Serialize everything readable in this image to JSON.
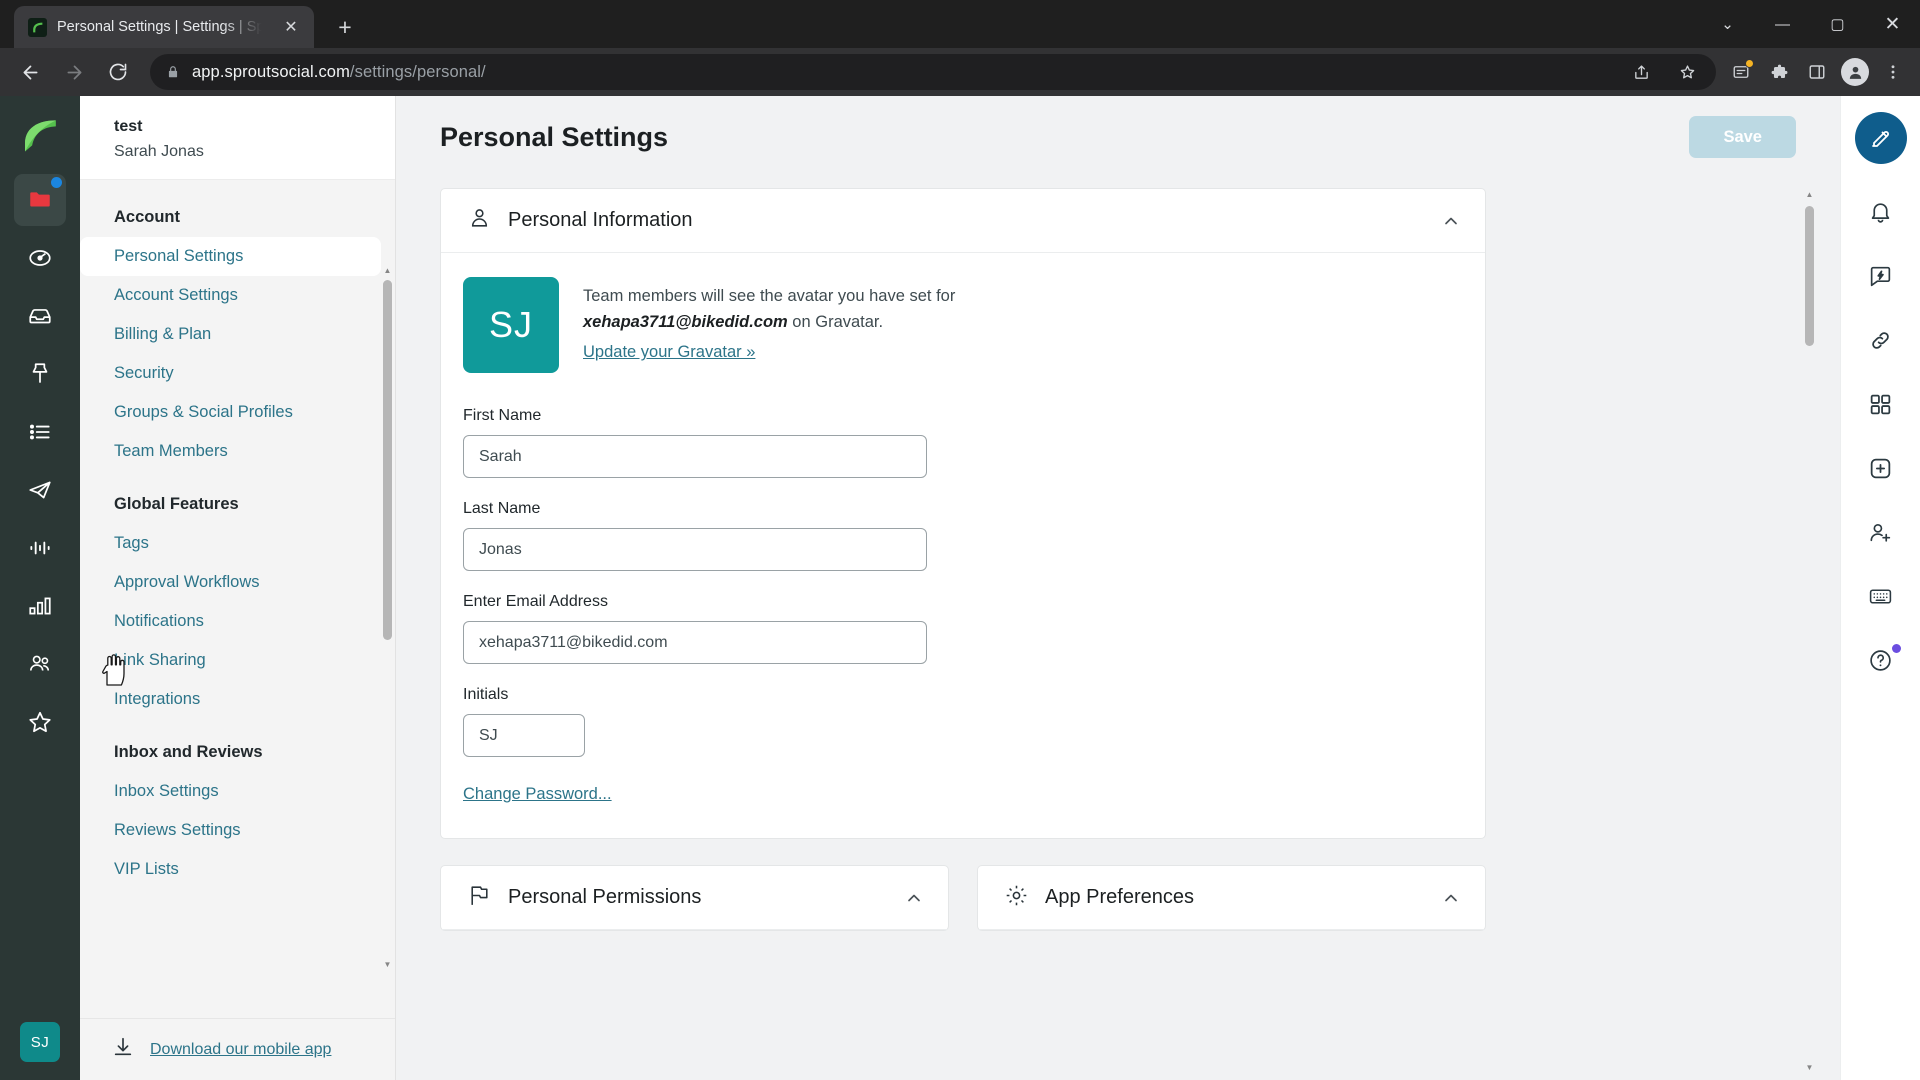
{
  "browser": {
    "tab": {
      "title": "Personal Settings | Settings | Spr",
      "favicon_name": "sprout-leaf-favicon",
      "close_label": "✕"
    },
    "new_tab_label": "+",
    "window_controls": {
      "minimize": "⌄",
      "restore": "—",
      "maximize": "▢",
      "close": "✕"
    },
    "url": {
      "host": "app.sproutsocial.com",
      "path": "/settings/personal/"
    },
    "omni_icons": [
      "share-icon",
      "bookmark-star-icon",
      "extension-update-icon",
      "puzzle-extensions-icon",
      "side-panel-icon",
      "profile-avatar-icon",
      "browser-menu-icon"
    ]
  },
  "left_rail": {
    "logo_name": "sprout-social-logo",
    "items": [
      {
        "name": "messages-folder-icon",
        "badge": true
      },
      {
        "name": "dashboard-speedometer-icon",
        "badge": false
      },
      {
        "name": "smart-inbox-icon",
        "badge": false
      },
      {
        "name": "pin-publishing-icon",
        "badge": false
      },
      {
        "name": "tasks-list-icon",
        "badge": false
      },
      {
        "name": "send-paper-plane-icon",
        "badge": false
      },
      {
        "name": "listening-waveform-icon",
        "badge": false
      },
      {
        "name": "reports-bar-chart-icon",
        "badge": false
      },
      {
        "name": "employee-advocacy-people-icon",
        "badge": false
      },
      {
        "name": "star-favorites-icon",
        "badge": false
      }
    ],
    "avatar_initials": "SJ"
  },
  "sidebar": {
    "account_name": "test",
    "user_name": "Sarah Jonas",
    "groups": [
      {
        "label": "Account",
        "items": [
          {
            "label": "Personal Settings",
            "active": true
          },
          {
            "label": "Account Settings",
            "active": false
          },
          {
            "label": "Billing & Plan",
            "active": false
          },
          {
            "label": "Security",
            "active": false
          },
          {
            "label": "Groups & Social Profiles",
            "active": false
          },
          {
            "label": "Team Members",
            "active": false
          }
        ]
      },
      {
        "label": "Global Features",
        "items": [
          {
            "label": "Tags",
            "active": false
          },
          {
            "label": "Approval Workflows",
            "active": false
          },
          {
            "label": "Notifications",
            "active": false
          },
          {
            "label": "Link Sharing",
            "active": false
          },
          {
            "label": "Integrations",
            "active": false
          }
        ]
      },
      {
        "label": "Inbox and Reviews",
        "items": [
          {
            "label": "Inbox Settings",
            "active": false
          },
          {
            "label": "Reviews Settings",
            "active": false
          },
          {
            "label": "VIP Lists",
            "active": false
          }
        ]
      }
    ],
    "footer": {
      "icon_name": "download-icon",
      "link_label": "Download our mobile app"
    }
  },
  "header": {
    "title": "Personal Settings",
    "save_label": "Save"
  },
  "personal_information": {
    "icon_name": "person-outline-icon",
    "title": "Personal Information",
    "collapse_icon": "chevron-up-icon",
    "avatar_initials": "SJ",
    "avatar_desc_line1": "Team members will see the avatar you have set for",
    "avatar_email": "xehapa3711@bikedid.com",
    "avatar_desc_line2": "on Gravatar.",
    "gravatar_link": "Update your Gravatar »",
    "fields": [
      {
        "label": "First Name",
        "value": "Sarah",
        "name": "first-name-input",
        "size": "wide"
      },
      {
        "label": "Last Name",
        "value": "Jonas",
        "name": "last-name-input",
        "size": "wide"
      },
      {
        "label": "Enter Email Address",
        "value": "xehapa3711@bikedid.com",
        "name": "email-input",
        "size": "wide"
      },
      {
        "label": "Initials",
        "value": "SJ",
        "name": "initials-input",
        "size": "small"
      }
    ],
    "change_password_label": "Change Password..."
  },
  "lower_cards": [
    {
      "icon_name": "permissions-flag-icon",
      "title": "Personal Permissions",
      "collapse_icon": "chevron-up-icon"
    },
    {
      "icon_name": "gear-preferences-icon",
      "title": "App Preferences",
      "collapse_icon": "chevron-up-icon"
    }
  ],
  "right_rail": {
    "compose_name": "compose-button",
    "items": [
      {
        "name": "notifications-bell-icon",
        "badge": false
      },
      {
        "name": "feedback-bolt-icon",
        "badge": false
      },
      {
        "name": "link-icon",
        "badge": false
      },
      {
        "name": "apps-grid-icon",
        "badge": false
      },
      {
        "name": "add-plus-icon",
        "badge": false
      },
      {
        "name": "invite-user-icon",
        "badge": false
      },
      {
        "name": "keyboard-shortcuts-icon",
        "badge": false
      },
      {
        "name": "help-question-icon",
        "badge": true
      }
    ]
  },
  "colors": {
    "brand_green": "#55c04d",
    "rail_bg": "#2b3735",
    "link_teal": "#2c7489",
    "avatar_teal": "#109a9a",
    "save_disabled": "#bcd9e3",
    "compose_blue": "#0f5d8c"
  }
}
